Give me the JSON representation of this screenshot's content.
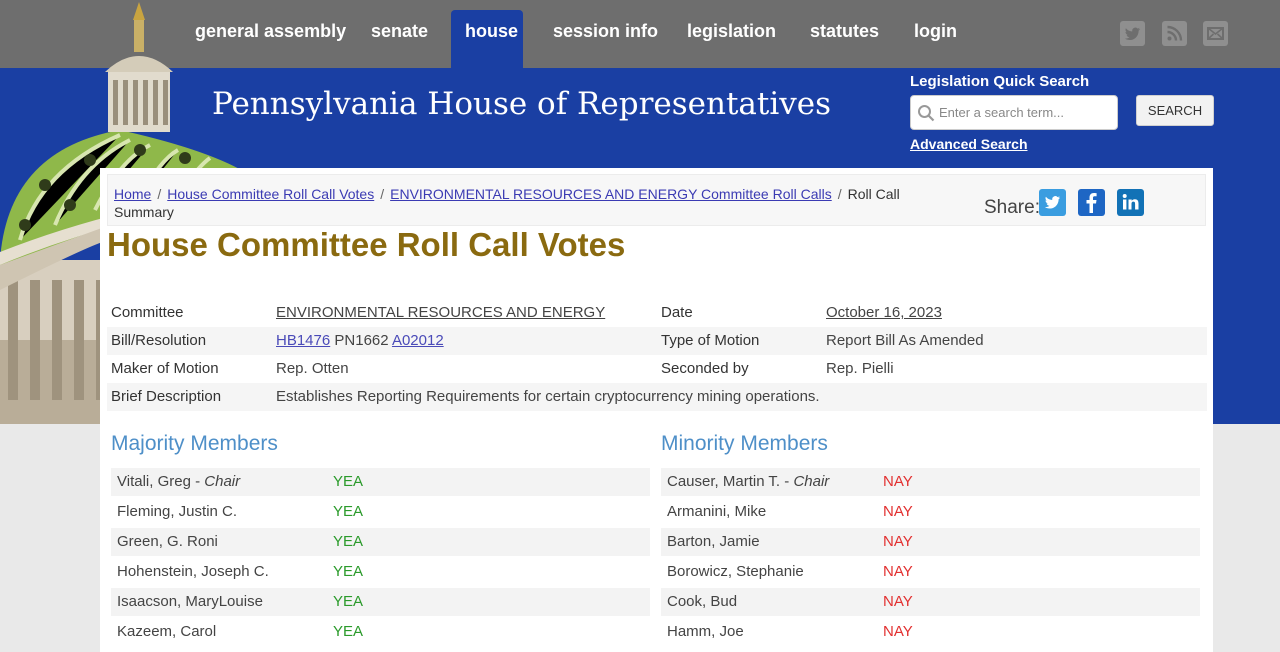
{
  "nav": {
    "items": [
      "general assembly",
      "senate",
      "house",
      "session info",
      "legislation",
      "statutes",
      "login"
    ],
    "active": "house",
    "social_icons": [
      "twitter-icon",
      "rss-icon",
      "mail-icon"
    ]
  },
  "banner": {
    "title": "Pennsylvania House of Representatives",
    "quick_search_title": "Legislation Quick Search",
    "search_placeholder": "Enter a search term...",
    "search_button": "SEARCH",
    "advanced_search": "Advanced Search"
  },
  "breadcrumb": {
    "items": [
      "Home",
      "House Committee Roll Call Votes",
      "ENVIRONMENTAL RESOURCES AND ENERGY Committee Roll Calls"
    ],
    "current": "Roll Call Summary",
    "share_label": "Share:"
  },
  "page_title": "House Committee Roll Call Votes",
  "details": {
    "committee_label": "Committee",
    "committee_value": "ENVIRONMENTAL RESOURCES AND ENERGY",
    "date_label": "Date",
    "date_value": "October 16, 2023",
    "bill_label": "Bill/Resolution",
    "bill_value": "HB1476",
    "bill_pn": "PN1662",
    "bill_amendment": "A02012",
    "motion_type_label": "Type of Motion",
    "motion_type_value": "Report Bill As Amended",
    "maker_label": "Maker of Motion",
    "maker_value": "Rep. Otten",
    "seconded_label": "Seconded by",
    "seconded_value": "Rep. Pielli",
    "brief_label": "Brief Description",
    "brief_value": "Establishes Reporting Requirements for certain cryptocurrency mining operations."
  },
  "majority": {
    "heading": "Majority Members",
    "members": [
      {
        "name": "Vitali, Greg - ",
        "role": "Chair",
        "vote": "YEA"
      },
      {
        "name": "Fleming, Justin C.",
        "role": "",
        "vote": "YEA"
      },
      {
        "name": "Green, G. Roni",
        "role": "",
        "vote": "YEA"
      },
      {
        "name": "Hohenstein, Joseph C.",
        "role": "",
        "vote": "YEA"
      },
      {
        "name": "Isaacson, MaryLouise",
        "role": "",
        "vote": "YEA"
      },
      {
        "name": "Kazeem, Carol",
        "role": "",
        "vote": "YEA"
      }
    ]
  },
  "minority": {
    "heading": "Minority Members",
    "members": [
      {
        "name": "Causer, Martin T. - ",
        "role": "Chair",
        "vote": "NAY"
      },
      {
        "name": "Armanini, Mike",
        "role": "",
        "vote": "NAY"
      },
      {
        "name": "Barton, Jamie",
        "role": "",
        "vote": "NAY"
      },
      {
        "name": "Borowicz, Stephanie",
        "role": "",
        "vote": "NAY"
      },
      {
        "name": "Cook, Bud",
        "role": "",
        "vote": "NAY"
      },
      {
        "name": "Hamm, Joe",
        "role": "",
        "vote": "NAY"
      }
    ]
  }
}
